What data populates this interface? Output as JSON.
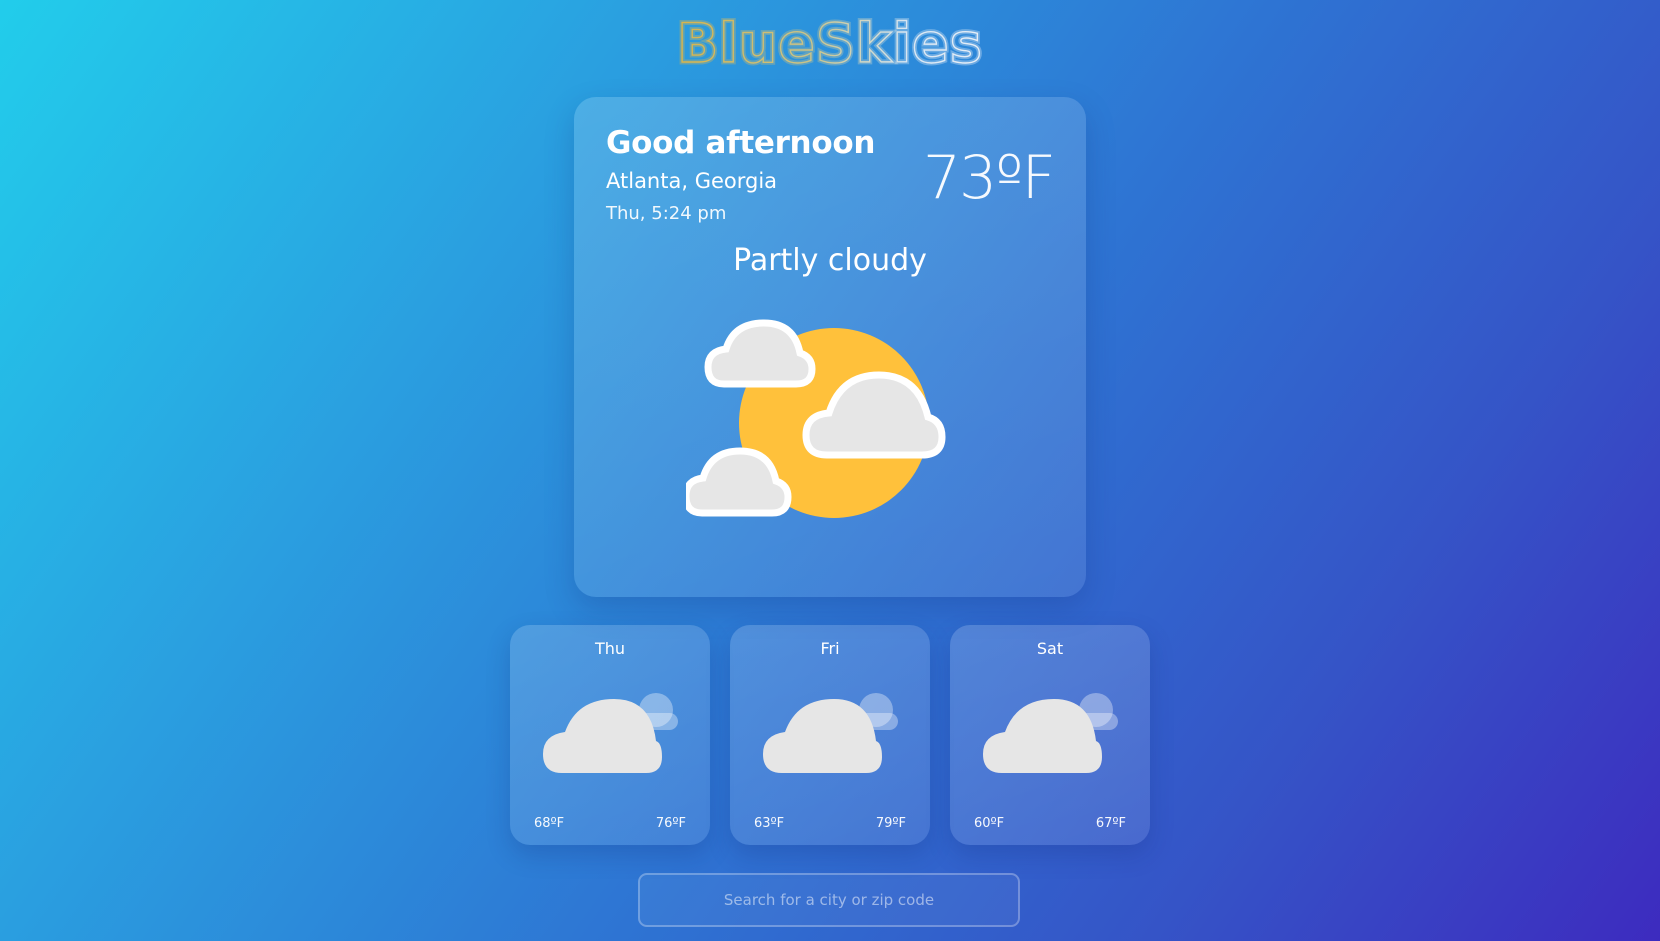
{
  "app": {
    "logo_text": "BlueSkies"
  },
  "current": {
    "greeting": "Good afternoon",
    "location": "Atlanta, Georgia",
    "datetime": "Thu, 5:24 pm",
    "temperature": "73ºF",
    "condition": "Partly cloudy",
    "icon": "partly-cloudy-icon"
  },
  "forecast": [
    {
      "day": "Thu",
      "low": "68ºF",
      "high": "76ºF",
      "icon": "cloudy-icon"
    },
    {
      "day": "Fri",
      "low": "63ºF",
      "high": "79ºF",
      "icon": "cloudy-icon"
    },
    {
      "day": "Sat",
      "low": "60ºF",
      "high": "67ºF",
      "icon": "cloudy-icon"
    }
  ],
  "search": {
    "placeholder": "Search for a city or zip code",
    "value": ""
  },
  "colors": {
    "sun": "#ffc13b",
    "cloud": "#e8e8e8",
    "logo_gold": "#d6b74a",
    "logo_light": "#cfe6f5"
  }
}
